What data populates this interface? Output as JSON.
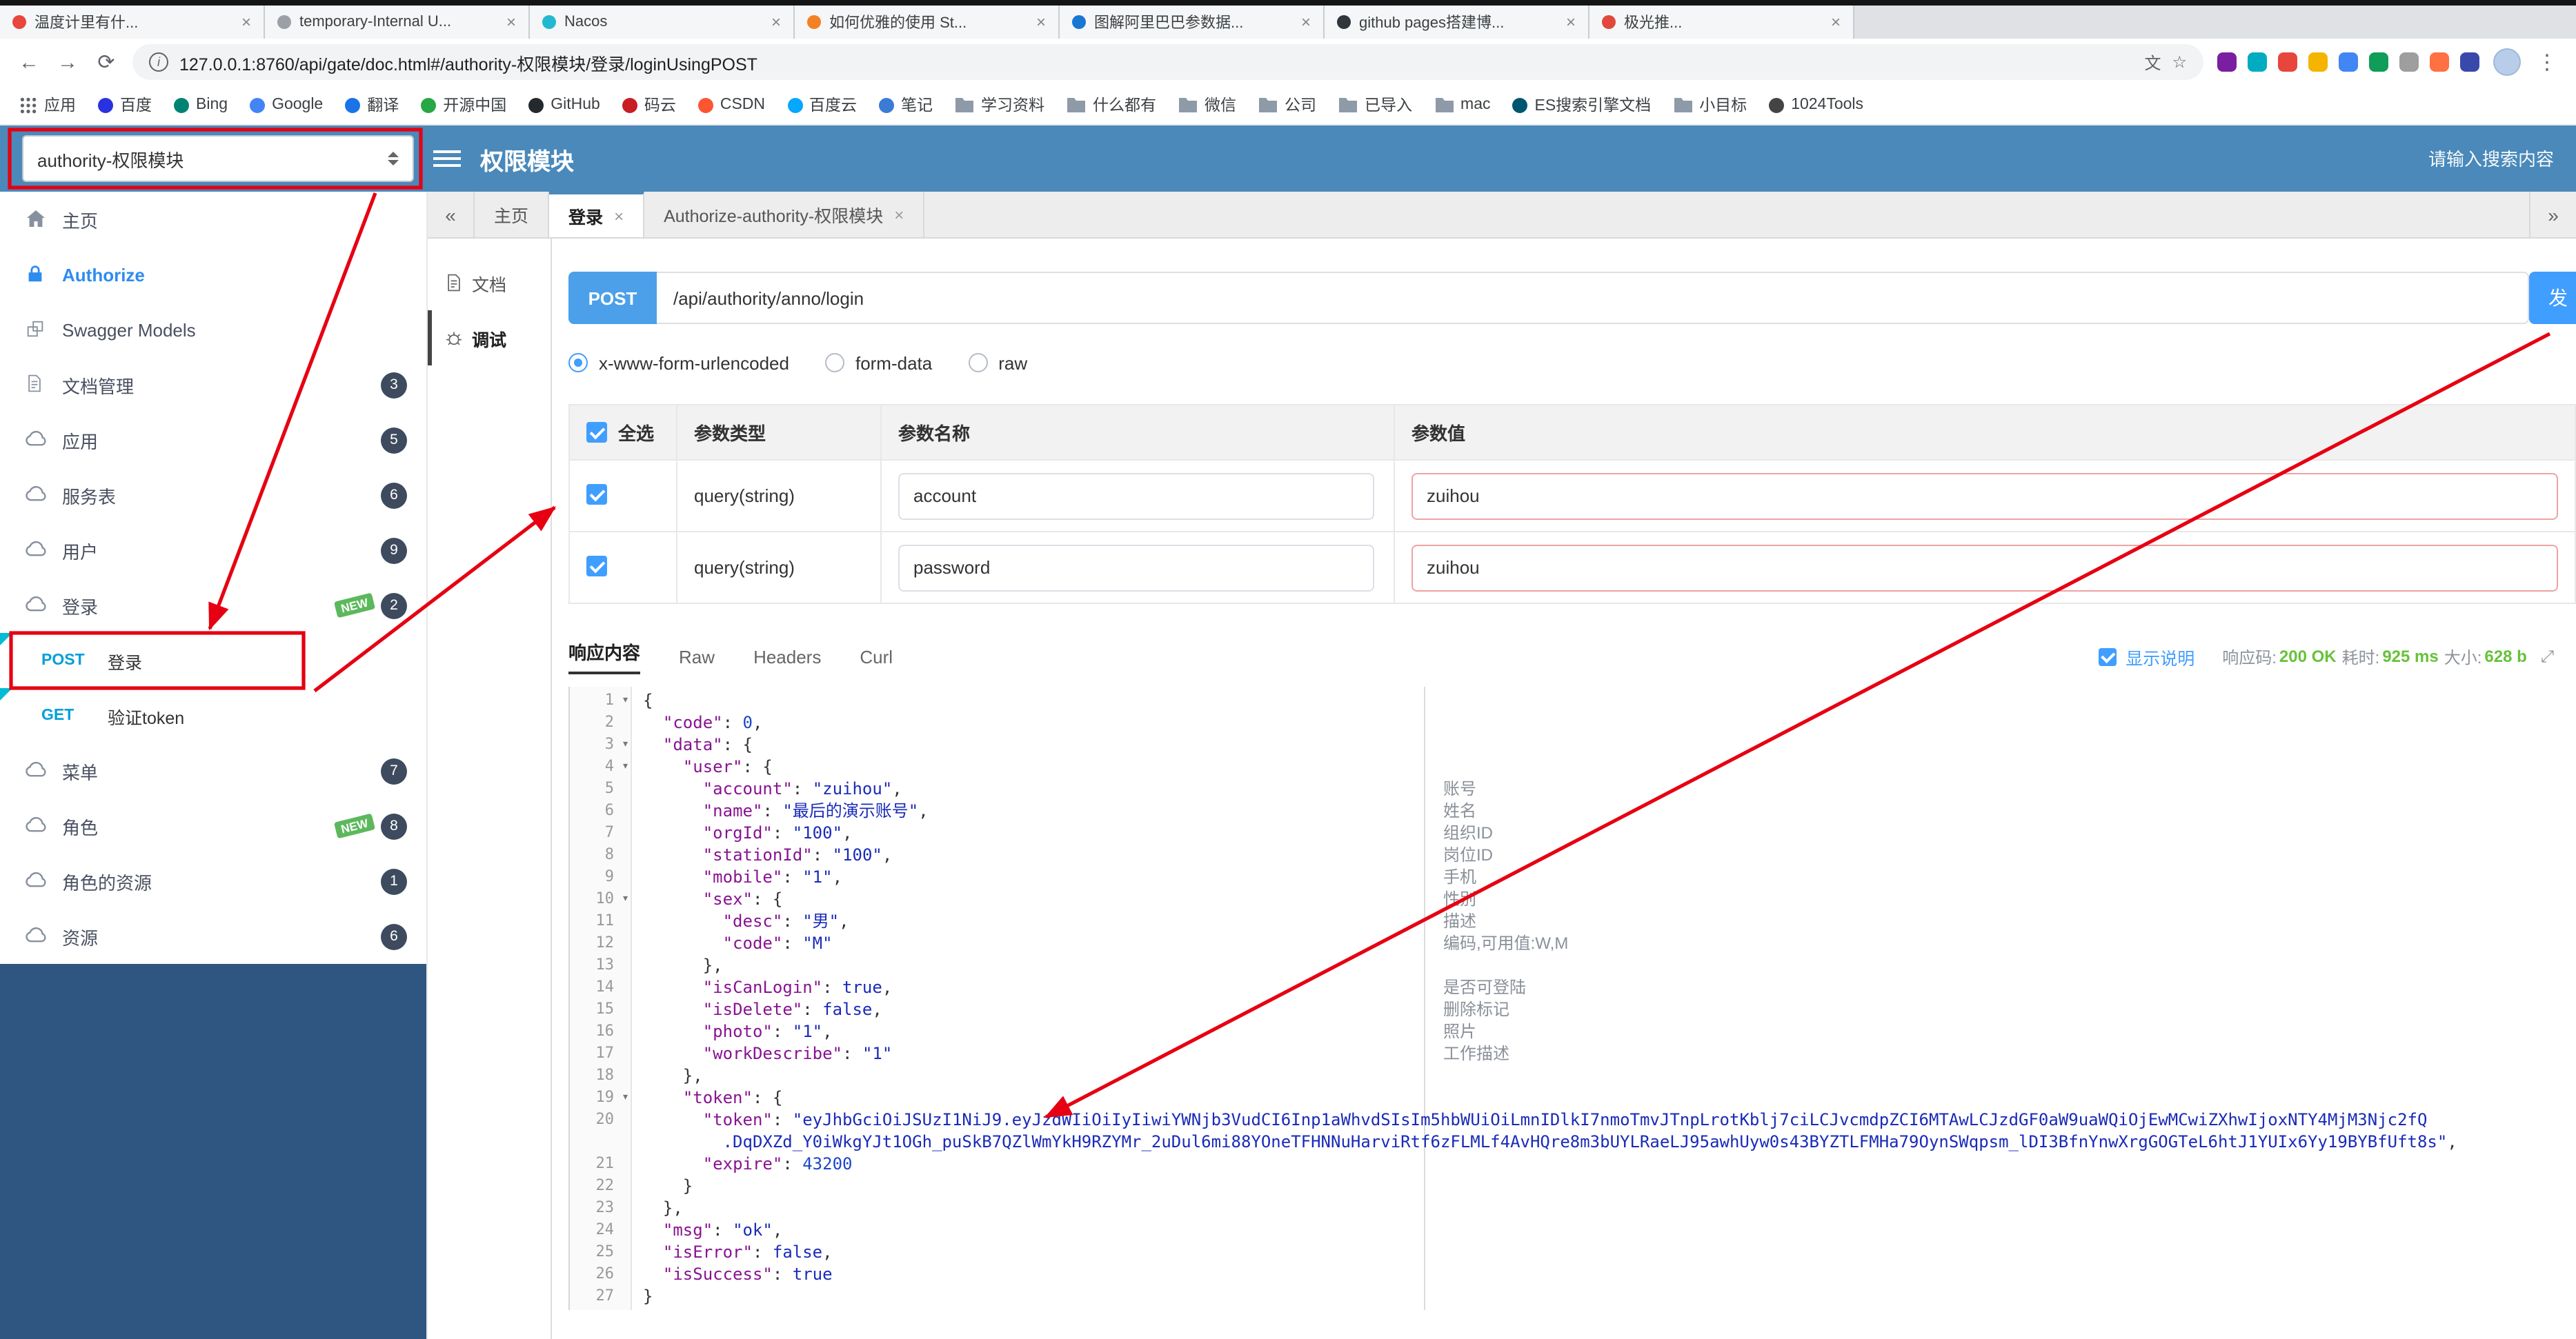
{
  "icons": {
    "back": "←",
    "forward": "→",
    "reload": "⟳",
    "info": "i",
    "star": "☆",
    "translate": "文",
    "menu": "⋮",
    "close": "×",
    "fold": "▾",
    "left_chevron": "«",
    "right_chevron": "»",
    "expand": "⤢"
  },
  "browser": {
    "tabs": [
      {
        "title": "温度计里有什...",
        "color": "#e8453c"
      },
      {
        "title": "temporary-Internal U...",
        "color": "#9aa0a6"
      },
      {
        "title": "Nacos",
        "color": "#22b8cf"
      },
      {
        "title": "如何优雅的使用 St...",
        "color": "#f48024"
      },
      {
        "title": "图解阿里巴巴参数据...",
        "color": "#1976d2"
      },
      {
        "title": "github pages搭建博...",
        "color": "#30363d"
      },
      {
        "title": "极光推...",
        "color": "#e0483e"
      }
    ],
    "address": {
      "url": "127.0.0.1:8760/api/gate/doc.html#/authority-权限模块/登录/loginUsingPOST"
    },
    "extensions": [
      "#7b1fa2",
      "#00acc1",
      "#e8453c",
      "#f4b400",
      "#4285f4",
      "#0f9d58",
      "#9e9e9e",
      "#ff7043",
      "#3949ab"
    ],
    "bookmarks": [
      {
        "label": "应用",
        "kind": "grid"
      },
      {
        "label": "百度",
        "kind": "dot",
        "color": "#2932e1"
      },
      {
        "label": "Bing",
        "kind": "dot",
        "color": "#008373"
      },
      {
        "label": "Google",
        "kind": "dot",
        "color": "#4285f4"
      },
      {
        "label": "翻译",
        "kind": "dot",
        "color": "#1a73e8"
      },
      {
        "label": "开源中国",
        "kind": "dot",
        "color": "#28a745"
      },
      {
        "label": "GitHub",
        "kind": "dot",
        "color": "#24292e"
      },
      {
        "label": "码云",
        "kind": "dot",
        "color": "#c71d23"
      },
      {
        "label": "CSDN",
        "kind": "dot",
        "color": "#fc5531"
      },
      {
        "label": "百度云",
        "kind": "dot",
        "color": "#06a7ff"
      },
      {
        "label": "笔记",
        "kind": "dot",
        "color": "#3a7bd5"
      },
      {
        "label": "学习资料",
        "kind": "folder"
      },
      {
        "label": "什么都有",
        "kind": "folder"
      },
      {
        "label": "微信",
        "kind": "folder"
      },
      {
        "label": "公司",
        "kind": "folder"
      },
      {
        "label": "已导入",
        "kind": "folder"
      },
      {
        "label": "mac",
        "kind": "folder"
      },
      {
        "label": "ES搜索引擎文档",
        "kind": "dot",
        "color": "#005571"
      },
      {
        "label": "小目标",
        "kind": "folder"
      },
      {
        "label": "1024Tools",
        "kind": "dot",
        "color": "#444444"
      }
    ]
  },
  "header": {
    "module_select": "authority-权限模块",
    "title": "权限模块",
    "search_placeholder": "请输入搜索内容"
  },
  "sidebar": {
    "items": [
      {
        "id": "home",
        "label": "主页",
        "icon": "home"
      },
      {
        "id": "authorize",
        "label": "Authorize",
        "icon": "lock",
        "accent": true
      },
      {
        "id": "swagger-models",
        "label": "Swagger Models",
        "icon": "models"
      },
      {
        "id": "doc-manage",
        "label": "文档管理",
        "icon": "doc",
        "badge": "3"
      },
      {
        "id": "app",
        "label": "应用",
        "icon": "cloud",
        "badge": "5"
      },
      {
        "id": "service",
        "label": "服务表",
        "icon": "cloud",
        "badge": "6"
      },
      {
        "id": "user",
        "label": "用户",
        "icon": "cloud",
        "badge": "9"
      },
      {
        "id": "login",
        "label": "登录",
        "icon": "cloud",
        "badge": "2",
        "new_tag": "NEW"
      },
      {
        "id": "login-post",
        "label": "登录",
        "method": "POST",
        "child": true,
        "marked": true
      },
      {
        "id": "verify-token-get",
        "label": "验证token",
        "method": "GET",
        "child": true,
        "marked": true
      },
      {
        "id": "menu",
        "label": "菜单",
        "icon": "cloud",
        "badge": "7"
      },
      {
        "id": "role",
        "label": "角色",
        "icon": "cloud",
        "badge": "8",
        "new_tag": "NEW"
      },
      {
        "id": "role-resource",
        "label": "角色的资源",
        "icon": "cloud",
        "badge": "1"
      },
      {
        "id": "resource",
        "label": "资源",
        "icon": "cloud",
        "badge": "6"
      }
    ]
  },
  "tabs_bar": {
    "tabs": [
      {
        "id": "home",
        "label": "主页",
        "closable": false
      },
      {
        "id": "login",
        "label": "登录",
        "closable": true,
        "active": true
      },
      {
        "id": "authorize-module",
        "label": "Authorize-authority-权限模块",
        "closable": true
      }
    ]
  },
  "doc_nav": [
    {
      "id": "doc",
      "label": "文档",
      "icon": "doc"
    },
    {
      "id": "debug",
      "label": "调试",
      "icon": "debug",
      "active": true
    }
  ],
  "debug": {
    "method": "POST",
    "url": "/api/authority/anno/login",
    "send_label": "发",
    "content_types": [
      {
        "label": "x-www-form-urlencoded",
        "checked": true
      },
      {
        "label": "form-data",
        "checked": false
      },
      {
        "label": "raw",
        "checked": false
      }
    ],
    "table": {
      "headers": [
        "全选",
        "参数类型",
        "参数名称",
        "参数值"
      ],
      "rows": [
        {
          "checked": true,
          "type": "query(string)",
          "name": "account",
          "value": "zuihou"
        },
        {
          "checked": true,
          "type": "query(string)",
          "name": "password",
          "value": "zuihou"
        }
      ]
    },
    "response_tabs": [
      "响应内容",
      "Raw",
      "Headers",
      "Curl"
    ],
    "show_desc_label": "显示说明",
    "meta": {
      "code_label": "响应码:",
      "code": "200 OK",
      "time_label": "耗时:",
      "time": "925 ms",
      "size_label": "大小:",
      "size": "628 b"
    }
  },
  "code": {
    "lines": [
      {
        "n": "1",
        "fold": true,
        "seg": [
          [
            "p",
            "{"
          ]
        ]
      },
      {
        "n": "2",
        "seg": [
          [
            "p",
            "  "
          ],
          [
            "k",
            "\"code\""
          ],
          [
            "p",
            ": "
          ],
          [
            "n",
            "0"
          ],
          [
            "p",
            ","
          ]
        ]
      },
      {
        "n": "3",
        "fold": true,
        "seg": [
          [
            "p",
            "  "
          ],
          [
            "k",
            "\"data\""
          ],
          [
            "p",
            ": {"
          ]
        ]
      },
      {
        "n": "4",
        "fold": true,
        "seg": [
          [
            "p",
            "    "
          ],
          [
            "k",
            "\"user\""
          ],
          [
            "p",
            ": {"
          ]
        ]
      },
      {
        "n": "5",
        "seg": [
          [
            "p",
            "      "
          ],
          [
            "k",
            "\"account\""
          ],
          [
            "p",
            ": "
          ],
          [
            "s",
            "\"zuihou\""
          ],
          [
            "p",
            ","
          ]
        ]
      },
      {
        "n": "6",
        "seg": [
          [
            "p",
            "      "
          ],
          [
            "k",
            "\"name\""
          ],
          [
            "p",
            ": "
          ],
          [
            "s",
            "\"最后的演示账号\""
          ],
          [
            "p",
            ","
          ]
        ]
      },
      {
        "n": "7",
        "seg": [
          [
            "p",
            "      "
          ],
          [
            "k",
            "\"orgId\""
          ],
          [
            "p",
            ": "
          ],
          [
            "s",
            "\"100\""
          ],
          [
            "p",
            ","
          ]
        ]
      },
      {
        "n": "8",
        "seg": [
          [
            "p",
            "      "
          ],
          [
            "k",
            "\"stationId\""
          ],
          [
            "p",
            ": "
          ],
          [
            "s",
            "\"100\""
          ],
          [
            "p",
            ","
          ]
        ]
      },
      {
        "n": "9",
        "seg": [
          [
            "p",
            "      "
          ],
          [
            "k",
            "\"mobile\""
          ],
          [
            "p",
            ": "
          ],
          [
            "s",
            "\"1\""
          ],
          [
            "p",
            ","
          ]
        ]
      },
      {
        "n": "10",
        "fold": true,
        "seg": [
          [
            "p",
            "      "
          ],
          [
            "k",
            "\"sex\""
          ],
          [
            "p",
            ": {"
          ]
        ]
      },
      {
        "n": "11",
        "seg": [
          [
            "p",
            "        "
          ],
          [
            "k",
            "\"desc\""
          ],
          [
            "p",
            ": "
          ],
          [
            "s",
            "\"男\""
          ],
          [
            "p",
            ","
          ]
        ]
      },
      {
        "n": "12",
        "seg": [
          [
            "p",
            "        "
          ],
          [
            "k",
            "\"code\""
          ],
          [
            "p",
            ": "
          ],
          [
            "s",
            "\"M\""
          ]
        ]
      },
      {
        "n": "13",
        "seg": [
          [
            "p",
            "      },"
          ]
        ]
      },
      {
        "n": "14",
        "seg": [
          [
            "p",
            "      "
          ],
          [
            "k",
            "\"isCanLogin\""
          ],
          [
            "p",
            ": "
          ],
          [
            "b",
            "true"
          ],
          [
            "p",
            ","
          ]
        ]
      },
      {
        "n": "15",
        "seg": [
          [
            "p",
            "      "
          ],
          [
            "k",
            "\"isDelete\""
          ],
          [
            "p",
            ": "
          ],
          [
            "b",
            "false"
          ],
          [
            "p",
            ","
          ]
        ]
      },
      {
        "n": "16",
        "seg": [
          [
            "p",
            "      "
          ],
          [
            "k",
            "\"photo\""
          ],
          [
            "p",
            ": "
          ],
          [
            "s",
            "\"1\""
          ],
          [
            "p",
            ","
          ]
        ]
      },
      {
        "n": "17",
        "seg": [
          [
            "p",
            "      "
          ],
          [
            "k",
            "\"workDescribe\""
          ],
          [
            "p",
            ": "
          ],
          [
            "s",
            "\"1\""
          ]
        ]
      },
      {
        "n": "18",
        "seg": [
          [
            "p",
            "    },"
          ]
        ]
      },
      {
        "n": "19",
        "fold": true,
        "seg": [
          [
            "p",
            "    "
          ],
          [
            "k",
            "\"token\""
          ],
          [
            "p",
            ": {"
          ]
        ]
      },
      {
        "n": "20",
        "seg": [
          [
            "p",
            "      "
          ],
          [
            "k",
            "\"token\""
          ],
          [
            "p",
            ": "
          ],
          [
            "s",
            "\"eyJhbGciOiJSUzI1NiJ9.eyJzdWIiOiIyIiwiYWNjb3VudCI6Inp1aWhvdSIsIm5hbWUiOiLmnIDlkI7nmoTmvJTnpLrotKblj7ciLCJvcmdpZCI6MTAwLCJzdGF0aW9uaWQiOjEwMCwiZXhwIjoxNTY4MjM3Njc2fQ"
          ]
        ]
      },
      {
        "n": "",
        "seg": [
          [
            "p",
            "        "
          ],
          [
            "s",
            ".DqDXZd_Y0iWkgYJt1OGh_puSkB7QZlWmYkH9RZYMr_2uDul6mi88YOneTFHNNuHarviRtf6zFLMLf4AvHQre8m3bUYLRaeLJ95awhUyw0s43BYZTLFMHa79OynSWqpsm_lDI3BfnYnwXrgGOGTeL6htJ1YUIx6Yy19BYBfUft8s\""
          ],
          [
            "p",
            ","
          ]
        ]
      },
      {
        "n": "21",
        "seg": [
          [
            "p",
            "      "
          ],
          [
            "k",
            "\"expire\""
          ],
          [
            "p",
            ": "
          ],
          [
            "n",
            "43200"
          ]
        ]
      },
      {
        "n": "22",
        "seg": [
          [
            "p",
            "    }"
          ]
        ]
      },
      {
        "n": "23",
        "seg": [
          [
            "p",
            "  },"
          ]
        ]
      },
      {
        "n": "24",
        "seg": [
          [
            "p",
            "  "
          ],
          [
            "k",
            "\"msg\""
          ],
          [
            "p",
            ": "
          ],
          [
            "s",
            "\"ok\""
          ],
          [
            "p",
            ","
          ]
        ]
      },
      {
        "n": "25",
        "seg": [
          [
            "p",
            "  "
          ],
          [
            "k",
            "\"isError\""
          ],
          [
            "p",
            ": "
          ],
          [
            "b",
            "false"
          ],
          [
            "p",
            ","
          ]
        ]
      },
      {
        "n": "26",
        "seg": [
          [
            "p",
            "  "
          ],
          [
            "k",
            "\"isSuccess\""
          ],
          [
            "p",
            ": "
          ],
          [
            "b",
            "true"
          ]
        ]
      },
      {
        "n": "27",
        "seg": [
          [
            "p",
            "}"
          ]
        ]
      }
    ],
    "annotations": [
      {
        "line": 5,
        "text": "账号"
      },
      {
        "line": 6,
        "text": "姓名"
      },
      {
        "line": 7,
        "text": "组织ID"
      },
      {
        "line": 8,
        "text": "岗位ID"
      },
      {
        "line": 9,
        "text": "手机"
      },
      {
        "line": 10,
        "text": "性别"
      },
      {
        "line": 11,
        "text": "描述"
      },
      {
        "line": 12,
        "text": "编码,可用值:W,M"
      },
      {
        "line": 14,
        "text": "是否可登陆"
      },
      {
        "line": 15,
        "text": "删除标记"
      },
      {
        "line": 16,
        "text": "照片"
      },
      {
        "line": 17,
        "text": "工作描述"
      }
    ]
  }
}
